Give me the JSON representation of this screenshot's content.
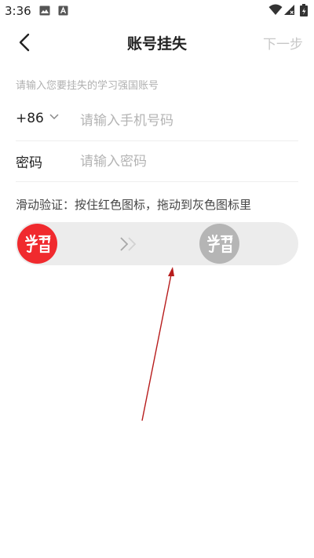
{
  "status_bar": {
    "time": "3:36"
  },
  "header": {
    "title": "账号挂失",
    "next_label": "下一步"
  },
  "hint": "请输入您要挂失的学习强国账号",
  "phone": {
    "country_code": "+86",
    "placeholder": "请输入手机号码",
    "value": ""
  },
  "password": {
    "label": "密码",
    "placeholder": "请输入密码",
    "value": ""
  },
  "slider": {
    "instruction": "滑动验证：按住红色图标，拖动到灰色图标里",
    "progress": 0
  },
  "colors": {
    "accent_red": "#f02a2e",
    "target_gray": "#b5b5b5",
    "track_bg": "#ececec",
    "annotation_arrow": "#b71c1c"
  },
  "icons": {
    "back": "chevron-left-icon",
    "dropdown": "chevron-down-icon",
    "slider_logo": "xuexi-logo-icon",
    "arrows": "double-chevron-right-icon"
  }
}
